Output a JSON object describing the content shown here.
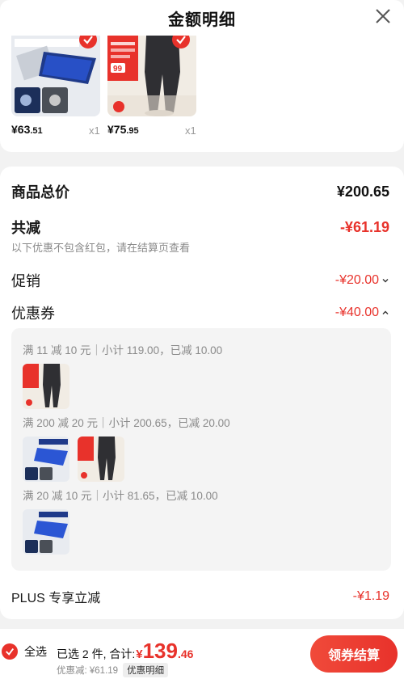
{
  "header": {
    "title": "金额明细"
  },
  "products": [
    {
      "price_int": "¥63",
      "price_dec": ".51",
      "qty": "x1"
    },
    {
      "price_int": "¥75",
      "price_dec": ".95",
      "qty": "x1",
      "tag_text": "99"
    }
  ],
  "summary": {
    "goods_total": {
      "label": "商品总价",
      "value": "¥200.65"
    },
    "total_discount": {
      "label": "共减",
      "value": "-¥61.19",
      "note": "以下优惠不包含红包，请在结算页查看"
    },
    "promotion": {
      "label": "促销",
      "value": "-¥20.00"
    },
    "coupon": {
      "label": "优惠券",
      "value": "-¥40.00",
      "details": [
        "满 11 减 10 元｜小计 119.00，已减 10.00",
        "满 200 减 20 元｜小计 200.65，已减 20.00",
        "满 20 减 10 元｜小计 81.65，已减 10.00"
      ]
    },
    "plus": {
      "label": "PLUS 专享立减",
      "value": "-¥1.19"
    }
  },
  "bottom_bar": {
    "select_all": "全选",
    "selected_text": "已选 2 件, 合计:",
    "total_yen": "¥",
    "total_int": "139",
    "total_dec": ".46",
    "discount_text": "优惠减: ¥61.19",
    "detail_tag": "优惠明细",
    "checkout_label": "领券结算"
  },
  "colors": {
    "accent": "#e8322b",
    "muted": "#8a8a8a",
    "card": "#ffffff",
    "page": "#f2f2f2"
  }
}
